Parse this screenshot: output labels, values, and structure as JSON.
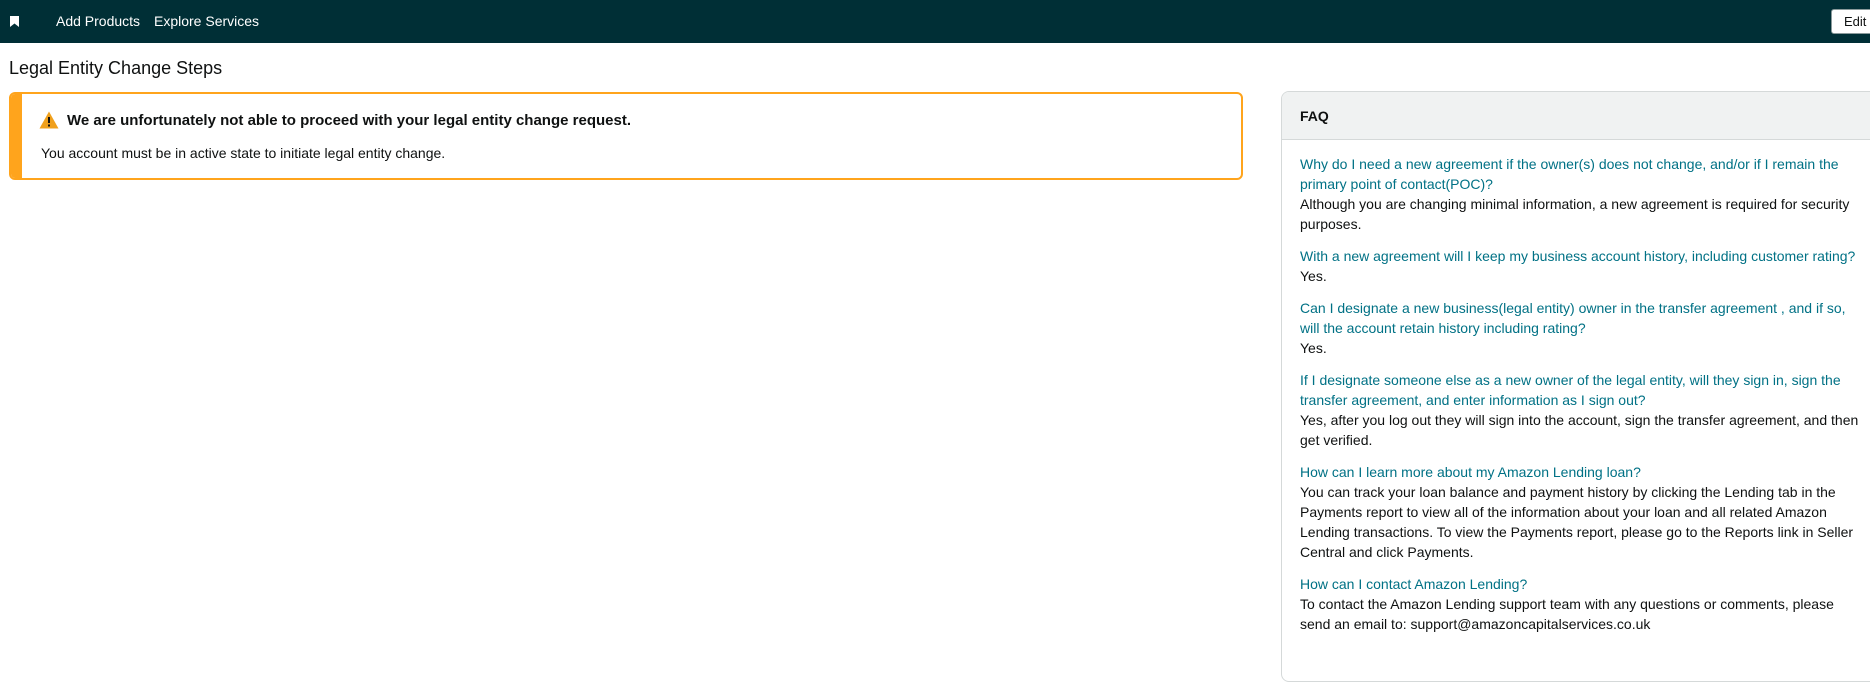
{
  "nav": {
    "add_products": "Add Products",
    "explore_services": "Explore Services",
    "edit": "Edit",
    "background_color": "#002f36"
  },
  "page": {
    "title": "Legal Entity Change Steps"
  },
  "alert": {
    "heading": "We are unfortunately not able to proceed with your legal entity change request.",
    "body": "You account must be in active state to initiate legal entity change.",
    "accent_color": "#ffa41c",
    "icon": "warning-icon"
  },
  "faq": {
    "title": "FAQ",
    "link_color": "#007185",
    "items": [
      {
        "question": "Why do I need a new agreement if the owner(s) does not change, and/or if I remain the primary point of contact(POC)?",
        "answer": "Although you are changing minimal information, a new agreement is required for security purposes."
      },
      {
        "question": "With a new agreement will I keep my business account history, including customer rating?",
        "answer": "Yes."
      },
      {
        "question": "Can I designate a new business(legal entity) owner in the transfer agreement , and if so, will the account retain history including rating?",
        "answer": "Yes."
      },
      {
        "question": "If I designate someone else as a new owner of the legal entity, will they sign in, sign the transfer agreement, and enter information as I sign out?",
        "answer": "Yes, after you log out they will sign into the account, sign the transfer agreement, and then get verified."
      },
      {
        "question": "How can I learn more about my Amazon Lending loan?",
        "answer": "You can track your loan balance and payment history by clicking the Lending tab in the Payments report to view all of the information about your loan and all related Amazon Lending transactions. To view the Payments report, please go to the Reports link in Seller Central and click Payments."
      },
      {
        "question": "How can I contact Amazon Lending?",
        "answer": "To contact the Amazon Lending support team with any questions or comments, please send an email to: support@amazoncapitalservices.co.uk"
      }
    ]
  }
}
